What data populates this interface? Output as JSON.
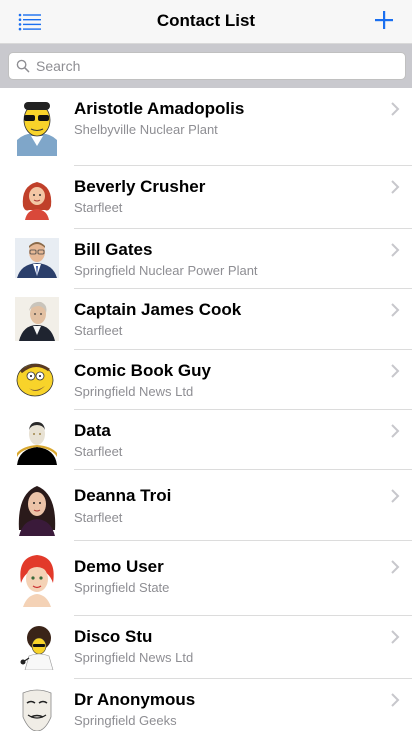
{
  "navbar": {
    "title": "Contact List",
    "accent_color": "#1a6ff0",
    "menu_icon": "list-icon",
    "add_icon": "plus-icon"
  },
  "search": {
    "placeholder": "Search",
    "value": ""
  },
  "contacts": [
    {
      "name": "Aristotle Amadopolis",
      "company": "Shelbyville Nuclear Plant",
      "avatar": "cartoon-man-sunglasses-avatar"
    },
    {
      "name": "Beverly Crusher",
      "company": "Starfleet",
      "avatar": "red-hair-woman-avatar"
    },
    {
      "name": "Bill Gates",
      "company": "Springfield Nuclear Power Plant",
      "avatar": "man-suit-glasses-avatar"
    },
    {
      "name": "Captain James Cook",
      "company": "Starfleet",
      "avatar": "portrait-painting-avatar"
    },
    {
      "name": "Comic Book Guy",
      "company": "Springfield News Ltd",
      "avatar": "cartoon-bearded-man-avatar"
    },
    {
      "name": "Data",
      "company": "Starfleet",
      "avatar": "android-officer-avatar"
    },
    {
      "name": "Deanna Troi",
      "company": "Starfleet",
      "avatar": "dark-hair-woman-avatar"
    },
    {
      "name": "Demo User",
      "company": "Springfield State",
      "avatar": "3d-red-hair-woman-avatar"
    },
    {
      "name": "Disco Stu",
      "company": "Springfield News Ltd",
      "avatar": "cartoon-afro-man-avatar"
    },
    {
      "name": "Dr Anonymous",
      "company": "Springfield Geeks",
      "avatar": "guy-fawkes-mask-avatar"
    }
  ]
}
